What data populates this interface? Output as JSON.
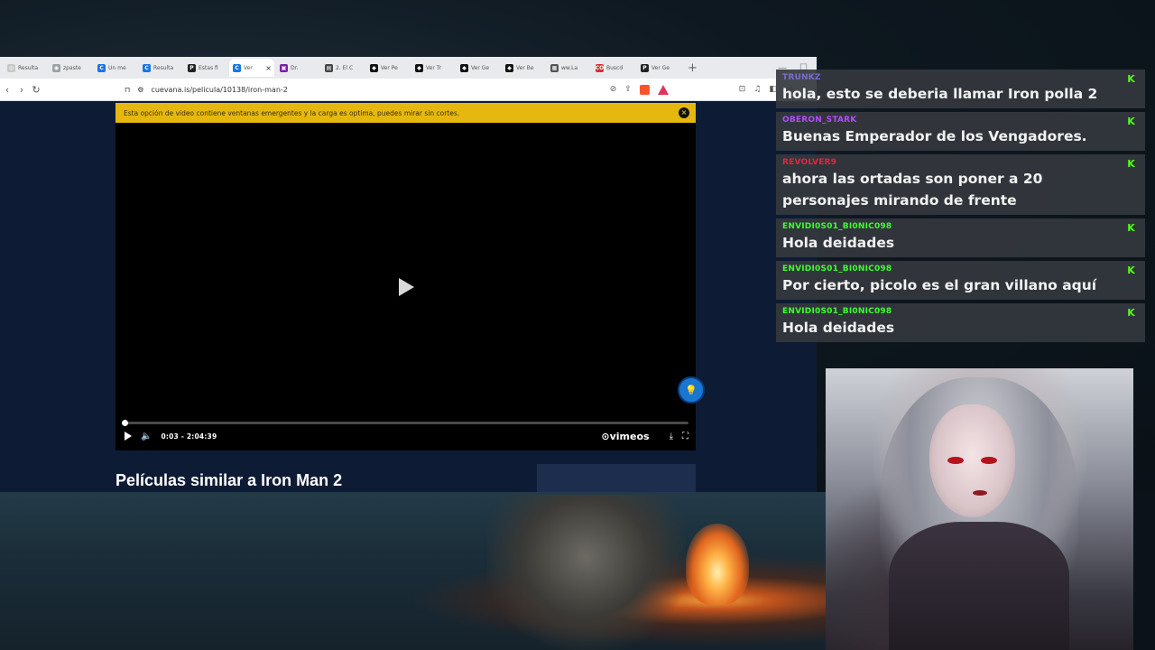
{
  "browser": {
    "tabs": [
      {
        "label": "Resulta",
        "fav_color": "#c7c7c7",
        "fav_glyph": "◎"
      },
      {
        "label": "zpaste",
        "fav_color": "#9aa0a6",
        "fav_glyph": "◉"
      },
      {
        "label": "Un me",
        "fav_color": "#1a73e8",
        "fav_glyph": "C"
      },
      {
        "label": "Resulta",
        "fav_color": "#1a73e8",
        "fav_glyph": "C"
      },
      {
        "label": "Estas fi",
        "fav_color": "#222222",
        "fav_glyph": "P"
      },
      {
        "label": "Ver",
        "fav_color": "#1a73e8",
        "fav_glyph": "C",
        "active": true
      },
      {
        "label": "Dr.",
        "fav_color": "#7b1fa2",
        "fav_glyph": "▣"
      },
      {
        "label": "2. El C",
        "fav_color": "#444444",
        "fav_glyph": "▤"
      },
      {
        "label": "Ver Pe",
        "fav_color": "#111111",
        "fav_glyph": "◆"
      },
      {
        "label": "Ver Tr",
        "fav_color": "#111111",
        "fav_glyph": "◆"
      },
      {
        "label": "Ver Ge",
        "fav_color": "#111111",
        "fav_glyph": "◆"
      },
      {
        "label": "Ver Be",
        "fav_color": "#111111",
        "fav_glyph": "◆"
      },
      {
        "label": "ww.La",
        "fav_color": "#555555",
        "fav_glyph": "▦"
      },
      {
        "label": "Buscd",
        "fav_color": "#d32f2f",
        "fav_glyph": "CO"
      },
      {
        "label": "Ver Ge",
        "fav_color": "#222222",
        "fav_glyph": "P"
      }
    ],
    "new_tab": "+",
    "url": "cuevana.is/pelicula/10138/iron-man-2"
  },
  "page": {
    "notice": "Esta opción de video contiene ventanas emergentes y la carga es optima, puedes mirar sin cortes.",
    "player": {
      "current_time": "0:03",
      "separator": "-",
      "duration": "2:04:39",
      "progress_percent": 0.04,
      "brand": "vimeo"
    },
    "similar_heading": "Películas similar a Iron Man 2"
  },
  "chat": {
    "messages": [
      {
        "user": "TRUNKZ",
        "user_color": "#7a6bd0",
        "text": "hola, esto se deberia llamar Iron polla 2"
      },
      {
        "user": "OBERON_STARK",
        "user_color": "#b44cff",
        "text": "Buenas Emperador de los Vengadores."
      },
      {
        "user": "REVOLVER9",
        "user_color": "#e0283c",
        "text": "ahora las ortadas son poner a 20 personajes mirando de frente"
      },
      {
        "user": "ENVIDI0S01_BI0NIC098",
        "user_color": "#3cff2d",
        "text": "Hola deidades"
      },
      {
        "user": "ENVIDI0S01_BI0NIC098",
        "user_color": "#3cff2d",
        "text": "Por cierto, picolo es el gran villano aquí"
      },
      {
        "user": "ENVIDI0S01_BI0NIC098",
        "user_color": "#3cff2d",
        "text": "Hola deidades"
      }
    ],
    "badge_glyph": "K",
    "badge_color": "#53fc18"
  }
}
